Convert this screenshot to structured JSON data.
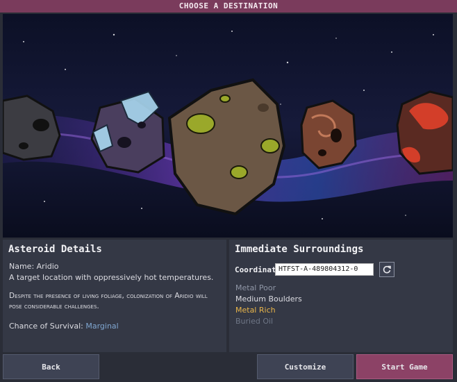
{
  "dialog": {
    "title": "CHOOSE A DESTINATION"
  },
  "details": {
    "heading": "Asteroid Details",
    "name_line": "Name: Aridio",
    "description": "A target location with oppressively hot temperatures.",
    "flavor": "Despite the presence of living foliage, colonization of Aridio will pose considerable challenges.",
    "survival_label": "Chance of Survival:",
    "survival_value": "Marginal"
  },
  "surroundings": {
    "heading": "Immediate Surroundings",
    "coordinate_label": "Coordinate:",
    "coordinate_value": "HTFST-A-489804312-0",
    "traits": [
      {
        "label": "Metal Poor",
        "color": "#8f96a6"
      },
      {
        "label": "Medium Boulders",
        "color": "#dcdce2"
      },
      {
        "label": "Metal Rich",
        "color": "#e8b54a"
      },
      {
        "label": "Buried Oil",
        "color": "#6f7686"
      }
    ]
  },
  "buttons": {
    "back": "Back",
    "customize": "Customize",
    "start": "Start Game"
  },
  "colors": {
    "accent": "#8c4266",
    "panel": "#343845",
    "survival": "#7fa6d0"
  }
}
